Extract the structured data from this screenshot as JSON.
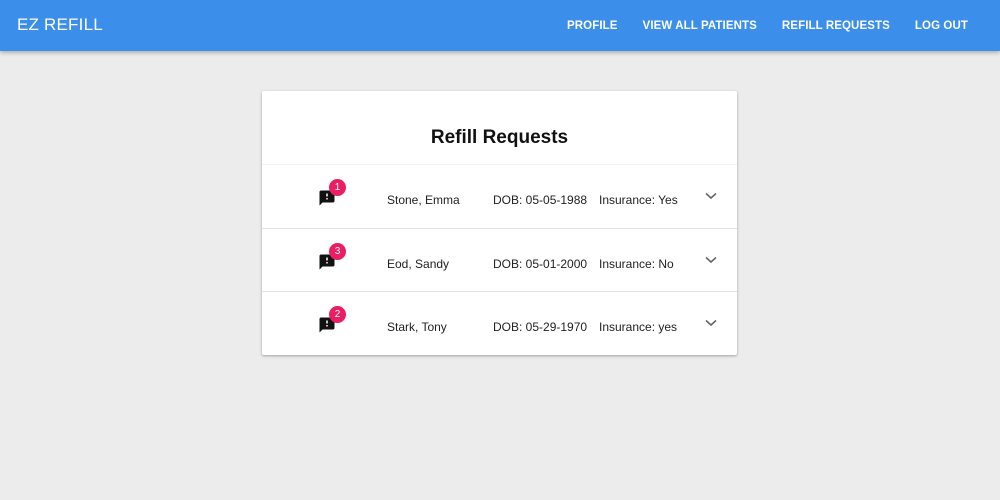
{
  "app": {
    "title": "EZ REFILL"
  },
  "nav": {
    "items": [
      {
        "label": "PROFILE"
      },
      {
        "label": "VIEW ALL PATIENTS"
      },
      {
        "label": "REFILL REQUESTS"
      },
      {
        "label": "LOG OUT"
      }
    ]
  },
  "colors": {
    "appbar": "#3b8eea",
    "badge": "#e91e63",
    "background": "#ececec"
  },
  "main": {
    "title": "Refill Requests",
    "rows": [
      {
        "badge": "1",
        "name": "Stone, Emma",
        "dob": "DOB: 05-05-1988",
        "insurance": "Insurance: Yes",
        "icon": "feedback-icon",
        "expand_icon": "chevron-down-icon"
      },
      {
        "badge": "3",
        "name": "Eod, Sandy",
        "dob": "DOB: 05-01-2000",
        "insurance": "Insurance: No",
        "icon": "feedback-icon",
        "expand_icon": "chevron-down-icon"
      },
      {
        "badge": "2",
        "name": "Stark, Tony",
        "dob": "DOB: 05-29-1970",
        "insurance": "Insurance: yes",
        "icon": "feedback-icon",
        "expand_icon": "chevron-down-icon"
      }
    ]
  }
}
